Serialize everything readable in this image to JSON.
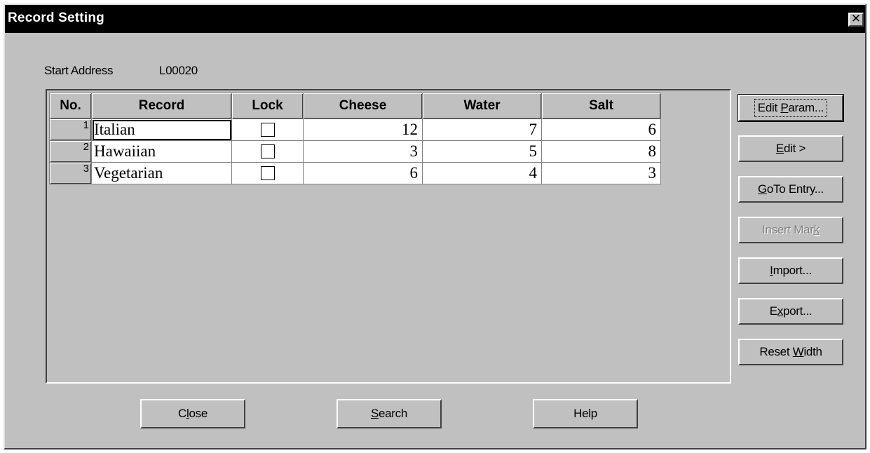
{
  "window": {
    "title": "Record Setting",
    "close_glyph": "✕"
  },
  "start_address": {
    "label": "Start Address",
    "value": "L00020"
  },
  "table": {
    "columns": [
      "No.",
      "Record",
      "Lock",
      "Cheese",
      "Water",
      "Salt"
    ],
    "rows": [
      {
        "no": "1",
        "record": "Italian",
        "lock": false,
        "cheese": "12",
        "water": "7",
        "salt": "6"
      },
      {
        "no": "2",
        "record": "Hawaiian",
        "lock": false,
        "cheese": "3",
        "water": "5",
        "salt": "8"
      },
      {
        "no": "3",
        "record": "Vegetarian",
        "lock": false,
        "cheese": "6",
        "water": "4",
        "salt": "3"
      }
    ]
  },
  "side_buttons": {
    "edit_param": {
      "pre": "Edit ",
      "key": "P",
      "post": "aram..."
    },
    "edit": {
      "pre": "",
      "key": "E",
      "post": "dit >"
    },
    "goto_entry": {
      "pre": "",
      "key": "G",
      "post": "oTo Entry..."
    },
    "insert_mark": {
      "pre": "Insert Mar",
      "key": "k",
      "post": ""
    },
    "import": {
      "pre": "",
      "key": "I",
      "post": "mport..."
    },
    "export": {
      "pre": "E",
      "key": "x",
      "post": "port..."
    },
    "reset_width": {
      "pre": "Reset ",
      "key": "W",
      "post": "idth"
    }
  },
  "bottom_buttons": {
    "close": {
      "pre": "C",
      "key": "l",
      "post": "ose"
    },
    "search": {
      "pre": "",
      "key": "S",
      "post": "earch"
    },
    "help": {
      "pre": "Help",
      "key": "",
      "post": ""
    }
  }
}
